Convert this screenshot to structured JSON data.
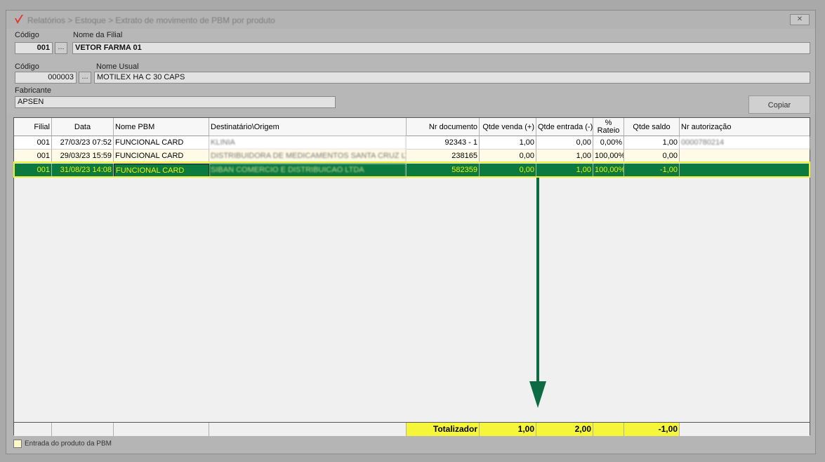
{
  "window": {
    "title": "Relatórios > Estoque > Extrato de movimento de PBM por produto",
    "close_label": "✕"
  },
  "filial": {
    "code_label": "Código",
    "code_value": "001",
    "name_label": "Nome da Filial",
    "name_value": "VETOR FARMA 01"
  },
  "produto": {
    "code_label": "Código",
    "code_value": "000003",
    "name_label": "Nome Usual",
    "name_value": "MOTILEX HA C 30 CAPS"
  },
  "fabricante": {
    "label": "Fabricante",
    "value": "APSEN"
  },
  "lookup_button_label": "...",
  "copy_button_label": "Copiar",
  "table": {
    "headers": {
      "filial": "Filial",
      "data": "Data",
      "nome_pbm": "Nome PBM",
      "destinatario": "Destinatário\\Origem",
      "nr_documento": "Nr documento",
      "qtde_venda": "Qtde venda (+)",
      "qtde_entrada": "Qtde entrada (-)",
      "rateio_top": "%",
      "rateio_bottom": "Rateio",
      "qtde_saldo": "Qtde saldo",
      "nr_autorizacao": "Nr autorização"
    },
    "rows": [
      {
        "filial": "001",
        "data": "27/03/23 07:52",
        "nome_pbm": "FUNCIONAL CARD",
        "destinatario": "KLINIA",
        "nr_documento": "92343 - 1",
        "qtde_venda": "1,00",
        "qtde_entrada": "0,00",
        "rateio": "0,00%",
        "qtde_saldo": "1,00",
        "nr_autorizacao": "0000780214"
      },
      {
        "filial": "001",
        "data": "29/03/23 15:59",
        "nome_pbm": "FUNCIONAL CARD",
        "destinatario": "DISTRIBUIDORA DE MEDICAMENTOS SANTA CRUZ LT",
        "nr_documento": "238165",
        "qtde_venda": "0,00",
        "qtde_entrada": "1,00",
        "rateio": "100,00%",
        "qtde_saldo": "0,00",
        "nr_autorizacao": ""
      },
      {
        "filial": "001",
        "data": "31/08/23 14:08",
        "nome_pbm": "FUNCIONAL CARD",
        "destinatario": "SIBAN COMERCIO E DISTRIBUICAO LTDA",
        "nr_documento": "582359",
        "qtde_venda": "0,00",
        "qtde_entrada": "1,00",
        "rateio": "100,00%",
        "qtde_saldo": "-1,00",
        "nr_autorizacao": ""
      }
    ],
    "totals": {
      "label": "Totalizador",
      "qtde_venda": "1,00",
      "qtde_entrada": "2,00",
      "qtde_saldo": "-1,00"
    }
  },
  "status_bar": {
    "checkbox_label": "Entrada do produto da PBM"
  },
  "colors": {
    "selected_row": "#0a7a3e",
    "highlight_yellow": "#f5f53a",
    "arrow": "#0d6b44"
  }
}
